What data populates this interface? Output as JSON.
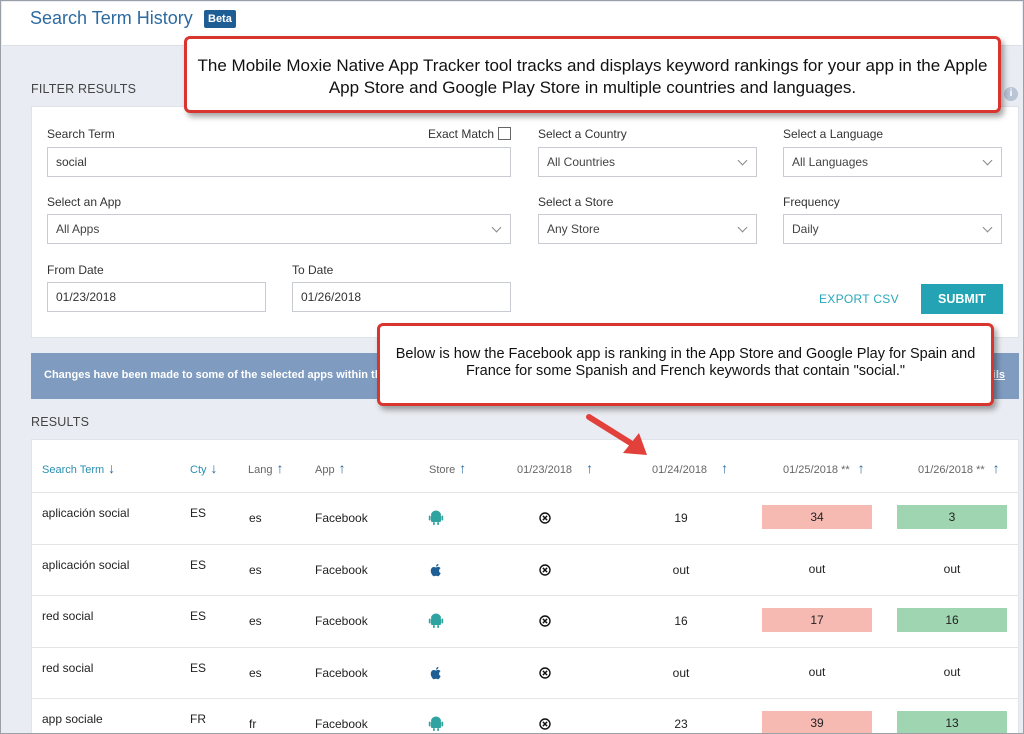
{
  "header": {
    "title": "Search Term History",
    "badge": "Beta"
  },
  "filter": {
    "section_label": "FILTER RESULTS",
    "search_term_label": "Search Term",
    "search_term_value": "social",
    "exact_match_label": "Exact Match",
    "exact_match_checked": false,
    "country_label": "Select a Country",
    "country_value": "All Countries",
    "language_label": "Select a Language",
    "language_value": "All Languages",
    "app_label": "Select an App",
    "app_value": "All Apps",
    "store_label": "Select a Store",
    "store_value": "Any Store",
    "frequency_label": "Frequency",
    "frequency_value": "Daily",
    "from_label": "From Date",
    "from_value": "01/23/2018",
    "to_label": "To Date",
    "to_value": "01/26/2018",
    "export_label": "EXPORT CSV",
    "submit_label": "SUBMIT"
  },
  "notice": {
    "text": "Changes have been made to some of the selected apps within the",
    "link": "ils"
  },
  "results": {
    "section_label": "RESULTS",
    "columns": [
      "Search Term",
      "Cty",
      "Lang",
      "App",
      "Store",
      "01/23/2018",
      "01/24/2018",
      "01/25/2018 **",
      "01/26/2018 **"
    ],
    "rows": [
      {
        "term": "aplicación social",
        "cty": "ES",
        "lang": "es",
        "app": "Facebook",
        "store": "android",
        "d1": "",
        "d2": "19",
        "d3": "34",
        "d3_color": "red",
        "d4": "3",
        "d4_color": "green"
      },
      {
        "term": "aplicación social",
        "cty": "ES",
        "lang": "es",
        "app": "Facebook",
        "store": "apple",
        "d1": "",
        "d2": "out",
        "d3": "out",
        "d3_color": "",
        "d4": "out",
        "d4_color": ""
      },
      {
        "term": "red social",
        "cty": "ES",
        "lang": "es",
        "app": "Facebook",
        "store": "android",
        "d1": "",
        "d2": "16",
        "d3": "17",
        "d3_color": "red",
        "d4": "16",
        "d4_color": "green"
      },
      {
        "term": "red social",
        "cty": "ES",
        "lang": "es",
        "app": "Facebook",
        "store": "apple",
        "d1": "",
        "d2": "out",
        "d3": "out",
        "d3_color": "",
        "d4": "out",
        "d4_color": ""
      },
      {
        "term": "app sociale",
        "cty": "FR",
        "lang": "fr",
        "app": "Facebook",
        "store": "android",
        "d1": "",
        "d2": "23",
        "d3": "39",
        "d3_color": "red",
        "d4": "13",
        "d4_color": "green"
      }
    ]
  },
  "callouts": {
    "top": "The Mobile Moxie Native App Tracker tool tracks and displays keyword rankings for your app in the Apple App Store and Google Play Store in multiple countries and languages.",
    "middle": "Below is how the Facebook app is ranking in the App Store and Google Play for Spain and France for some Spanish and French keywords that contain \"social.\""
  },
  "colors": {
    "accent": "#24a3b4",
    "brand": "#1f5e95",
    "worse": "#f7bab3",
    "better": "#9fd5b1",
    "callout_border": "#d9352f"
  }
}
